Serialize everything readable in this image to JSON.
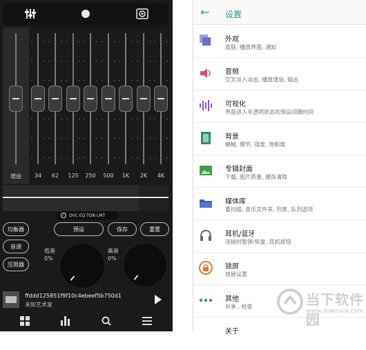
{
  "equalizer": {
    "top_tabs": [
      {
        "icon": "sliders-icon"
      },
      {
        "icon": "circle-icon"
      },
      {
        "icon": "speaker-icon"
      }
    ],
    "gain_label": "增益",
    "bands": [
      "34",
      "62",
      "125",
      "250",
      "500",
      "1K",
      "2K",
      "4K"
    ],
    "band_levels_db": [
      0,
      0,
      0,
      0,
      0,
      0,
      0,
      0,
      0
    ],
    "chip_info": "i",
    "chip_text": "DVC EQ TON LMT",
    "modes": [
      "均衡器",
      "音调",
      "压限器"
    ],
    "actions": {
      "preset": "预设",
      "save": "保存",
      "reset": "重置"
    },
    "bass": {
      "label": "低音",
      "value": "0%"
    },
    "treble": {
      "label": "高音",
      "value": "0%"
    },
    "now_playing": {
      "title": "ffddd125851f9f10c4ebeef5b750d1",
      "artist": "未知艺术家"
    },
    "nav_icons": [
      "grid-icon",
      "bars-icon",
      "search-icon",
      "menu-icon"
    ]
  },
  "settings": {
    "title": "设置",
    "back_icon": "←",
    "items": [
      {
        "title": "外观",
        "subtitle": "皮肤, 播放界面, 通知",
        "icon": "layers-icon",
        "color": "#6a6fc8"
      },
      {
        "title": "音频",
        "subtitle": "交叉淡入淡出, 播放增益, 输出",
        "icon": "volume-icon",
        "color": "#d64f6e"
      },
      {
        "title": "可视化",
        "subtitle": "界面进入半透明状态的预设间隔时间",
        "icon": "waveform-icon",
        "color": "#8e4fd0"
      },
      {
        "title": "背景",
        "subtitle": "模糊, 细节, 强度, 饱和度",
        "icon": "background-icon",
        "color": "#2f8f76"
      },
      {
        "title": "专辑封面",
        "subtitle": "下载, 图片质量, 缓存清除",
        "icon": "image-icon",
        "color": "#3f9b4e"
      },
      {
        "title": "媒体库",
        "subtitle": "重扫描, 音乐文件夹, 列表, 队列选项",
        "icon": "folder-icon",
        "color": "#3a5fb0"
      },
      {
        "title": "耳机/蓝牙",
        "subtitle": "连接时暂停/恢复, 耳机按钮",
        "icon": "headphones-icon",
        "color": "#666666"
      },
      {
        "title": "锁屏",
        "subtitle": "锁屏设置",
        "icon": "lock-icon",
        "color": "#e07a2a"
      },
      {
        "title": "其他",
        "subtitle": "共享 , 检查",
        "icon": "more-icon",
        "color": "#2b8f8a"
      },
      {
        "title": "关于",
        "subtitle": "",
        "icon": "info-icon",
        "color": "#888888"
      }
    ]
  },
  "watermark": {
    "text": "当下软件园",
    "url": "www.downxia.com"
  }
}
